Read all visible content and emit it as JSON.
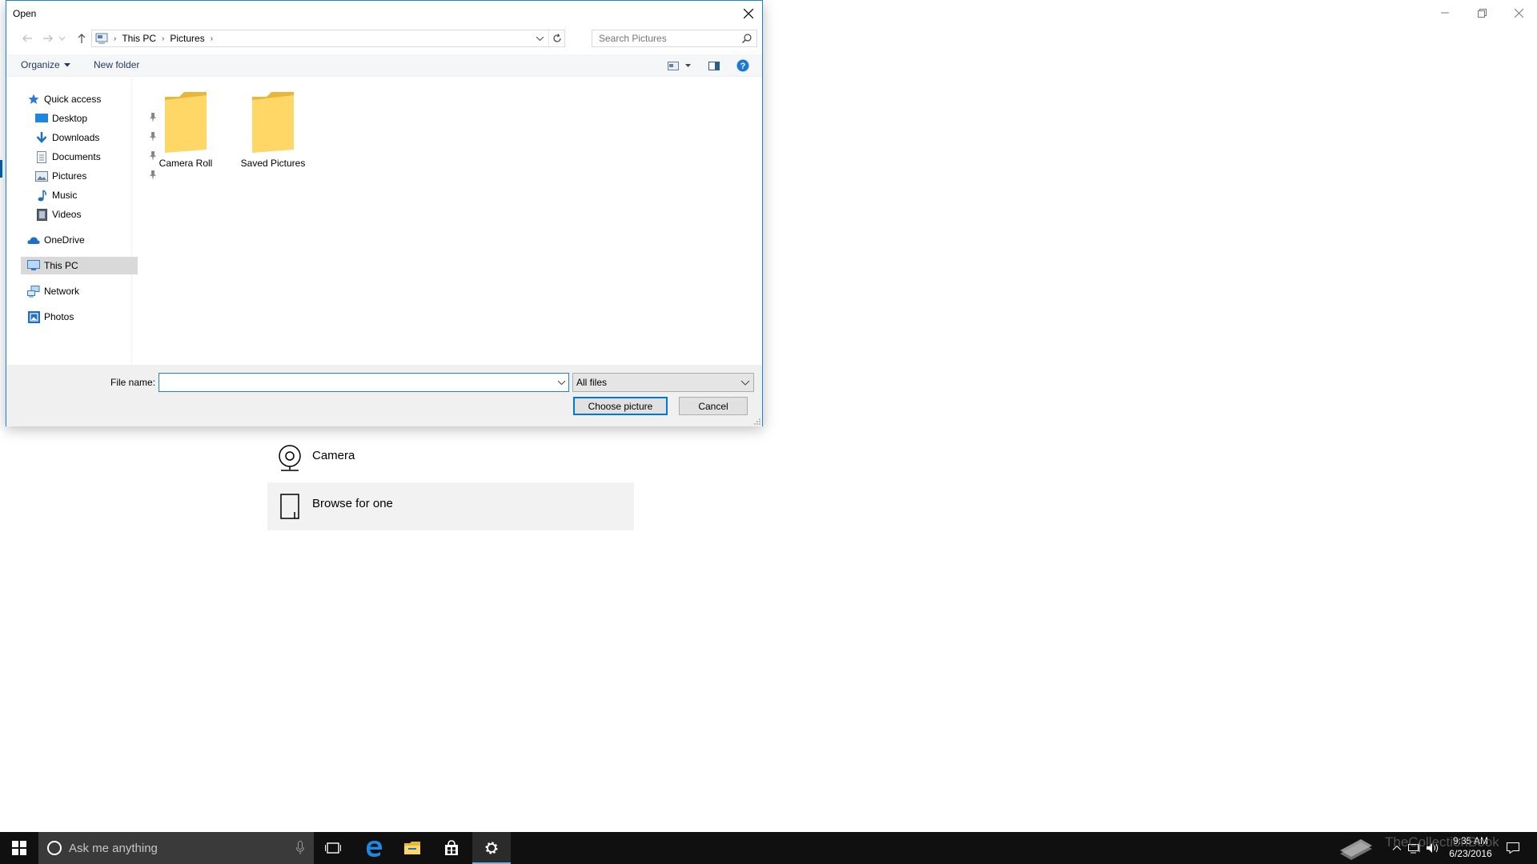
{
  "dialog": {
    "title": "Open",
    "breadcrumb": [
      "This PC",
      "Pictures"
    ],
    "search_placeholder": "Search Pictures",
    "toolbar": {
      "organize": "Organize",
      "new_folder": "New folder"
    },
    "nav": {
      "quick_access": "Quick access",
      "items": [
        {
          "label": "Desktop",
          "icon": "desktop-icon",
          "pinned": true
        },
        {
          "label": "Downloads",
          "icon": "downloads-icon",
          "pinned": true
        },
        {
          "label": "Documents",
          "icon": "documents-icon",
          "pinned": true
        },
        {
          "label": "Pictures",
          "icon": "pictures-icon",
          "pinned": true
        },
        {
          "label": "Music",
          "icon": "music-icon",
          "pinned": false
        },
        {
          "label": "Videos",
          "icon": "videos-icon",
          "pinned": false
        }
      ],
      "onedrive": "OneDrive",
      "this_pc": "This PC",
      "network": "Network",
      "photos": "Photos"
    },
    "folders": [
      "Camera Roll",
      "Saved Pictures"
    ],
    "footer": {
      "file_name_label": "File name:",
      "file_name_value": "",
      "file_type": "All files",
      "choose_button": "Choose picture",
      "cancel_button": "Cancel"
    }
  },
  "background": {
    "options": [
      "Camera",
      "Browse for one"
    ]
  },
  "taskbar": {
    "search_placeholder": "Ask me anything",
    "time": "9:35 AM",
    "date": "6/23/2016",
    "watermark": "TheCollectionBook"
  },
  "colors": {
    "accent": "#0078d7",
    "folder": "#ffd766",
    "taskbar": "#101010",
    "selection": "#d9d9d9"
  }
}
